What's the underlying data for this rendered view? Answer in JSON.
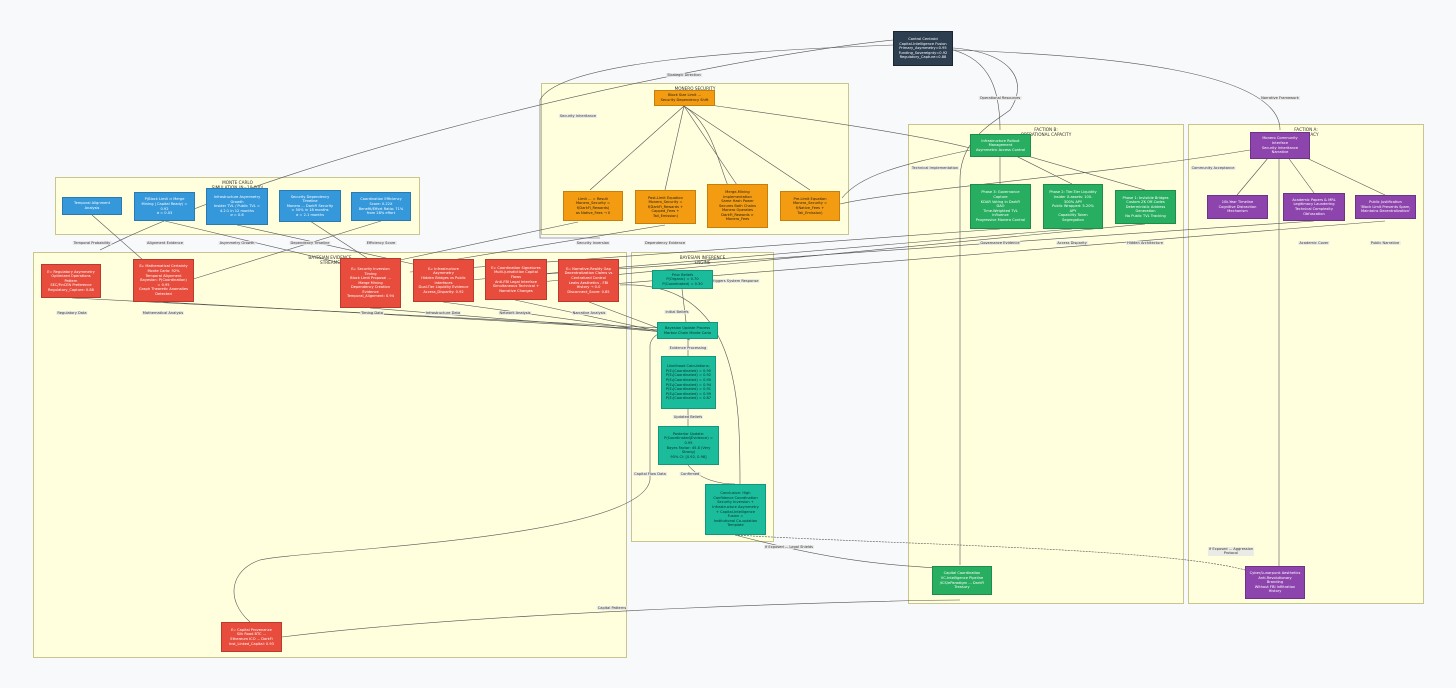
{
  "clusters": {
    "monero": "MONERO SECURITY",
    "monte": "MONTE CARLO\nSIMULATION (N=10,000)",
    "bayes_evidence": "BAYESIAN EVIDENCE\nSTREAMS",
    "bayes_engine": "BAYESIAN INFERENCE\nENGINE",
    "faction_b": "FACTION B:\nOPERATIONAL CAPACITY",
    "faction_a": "FACTION A:\nLEGITIMACY"
  },
  "nodes": {
    "control": "Control Centroid\nCapital-Intelligence Fusion\nPrimary_Asymmetry=0.95\nFunding_Sovereignty=0.92\nRegulatory_Capture=0.88",
    "monero_root": "Block Size Limit ...\nSecurity Dependency Shift",
    "limit": "Limit ... = Result\nMonero_Security =\nf(DarkFi_Rewards)\nas Native_Fees → 0",
    "postlimit": "Post-Limit Equation\nMonero_Security =\nf(DarkFi_Rewards +\nCapped_Fees +\nTail_Emission)",
    "merge": "Merge-Mining\nImplementation\nSame Hash Power\nSecures Both Chains\nMonero Operates\nDarkFi_Rewards >\nMonero_Fees",
    "prelimit": "Pre-Limit Equation\nMonero_Security =\nf(Native_Fees +\nTail_Emission)",
    "mc_temporal": "Temporal Alignment\nAnalysis",
    "mc_ppost": "P(Block Limit ⇒ Merge\nMining | Capital Ready) =\n0.92\nσ = 0.03",
    "mc_infra": "Infrastructure Asymmetry\nGrowth\nInsider TVL / Public TVL =\n4.2:1 in 12 months\nσ = 0.6",
    "mc_secdep": "Security Dependency\nTimeline\nMonero ... DarkFi Security\n> 50% in 18 months\nσ = 2.1 months",
    "mc_coord": "Coordination Efficiency\nScore: 0.22X\nBenefit/Effort Ratio: 71%\nfrom 28% effort",
    "ev_reg": "E₇: Regulatory Asymmetry\nOptimized Operations\nPattern\nSEC/FinCEN Preference\nRegulatory_Capture: 0.88",
    "ev_math": "E₆: Mathematical Certainty\nMonte Carlo: 92%\nTemporal Alignment\nBayesian: P(Coordination)\n= 0.95\nGraph Theoretic Anomalies\nDetected",
    "ev_secinv": "E₅: Security Inversion\nTiming\nBlock Limit Proposal ...\nMerge Mining\nDependency Creation\nEvidence\nTemporal_Alignment: 0.94",
    "ev_infra": "E₄: Infrastructure\nAsymmetry\nHidden Bridges vs Public\nInterfaces\nDual-Tier Liquidity Evidence\nAccess_Disparity: 0.92",
    "ev_coord": "E₃: Coordination Signatures\nMulti-Jurisdiction Capital\nFlows\nAnti-FBI Legal Interface\nSimultaneous Technical +\nNarrative Changes",
    "ev_narr": "E₂: Narrative-Reality Gap\nDecentralization Claims vs\nCentralized Control\nLeaks Aesthetics - FBI\nHistory → 0.0\nDisconnect_Score: 0.85",
    "ev_cap": "E₁: Capital Provenance\nSilk Road BTC ...\nEthereum ICO ... DarkFi\nInst_Linked_Capital: 0.93",
    "prior": "Prior Beliefs\nP(Organic) = 0.70\nP(Coordinated) = 0.30",
    "bayes_update": "Bayesian Update Process\nMarkov Chain Monte Carlo",
    "likelihood": "Likelihood Calculations:\nP(E₁|Coordinated) = 0.95\nP(E₂|Coordinated) = 0.92\nP(E₃|Coordinated) = 0.90\nP(E₄|Coordinated) = 0.94\nP(E₅|Coordinated) = 0.91\nP(E₆|Coordinated) = 0.99\nP(E₇|Coordinated) = 0.87",
    "posterior": "Posterior Update:\nP(Coordinated|Evidence) =\n0.95\nBayes Factor: 45.8 (Very\nStrong)\n95% CI: [0.92, 0.98]",
    "conclusion": "Conclusion: High\nConfidence Coordination\nSecurity Inversion +\nInfrastructure Asymmetry\n+ Capital-Intelligence\nFusion =\nInstitutional Co-optation\nTemplate",
    "fb_root": "Infrastructure Rollout\nManagement\nAsymmetric Access Control",
    "fb_p3": "Phase 3: Governance\nCapture\nKDAR Voting in DarkFi\nDAO\nTime-Weighted TVL\nInfluence\nProgressive Monero Control",
    "fb_p2": "Phase 2: Tier-Tier Liquidity\nInsider X-assets: 100-\n300% APY\nPublic Wrapped: 5-20%\nAPY\nCapability Token\nSegregation",
    "fb_p1": "Phase 1: Invisible Bridges\nCustom ZK Off-Codes\nDeterministic Address\nGeneration\nNo Public TVL Tracking",
    "fb_capital": "Capital Coordination\nVC-Intelligence Pipeline\n/ICS/eParadigm ... DarkFi\nTreasury",
    "fa_root": "Monero Community\nInterface\nSecurity Inheritance\nNarrative",
    "fa_10yr": "10k-Year Timeline\nCognitive Distraction\nMechanism",
    "fa_academic": "Academic Papers & MRL\nLegitimacy Laundering\nTechnical Complexity\nObfuscation",
    "fa_public": "Public Justification\n'Block Limit Prevents Spam,\nMaintains Decentralization'",
    "fa_cyber": "Cyber/Lunarpunk Aesthetics\nAnti-Revolutionary\nBranding\nWithout FBI Infiltration\nHistory"
  },
  "edge_labels": {
    "strategic": "Strategic Direction",
    "operational": "Operational Resources",
    "narrative": "Narrative Framework",
    "sec_inherit": "Security Inheritance",
    "tech_impl": "Technical Implementation",
    "community": "Community Acceptance",
    "temporal_prob": "Temporal Probability",
    "align_ev": "Alignment Evidence",
    "asym_growth": "Asymmetry Growth",
    "dep_timeline": "Dependency Timeline",
    "eff_score": "Efficiency Score",
    "sec_inversion": "Security Inversion",
    "dep_evidence": "Dependency Evidence",
    "gov_evidence": "Governance Evidence",
    "access_disparity": "Access Disparity",
    "hidden_arch": "Hidden Architecture",
    "academic_cover": "Academic Cover",
    "public_narr": "Public Narrative",
    "triggers": "Triggers System Response",
    "reg_data": "Regulatory Data",
    "math_analysis": "Mathematical Analysis",
    "timing_data": "Timing Data",
    "infra_data": "Infrastructure Data",
    "network_analysis": "Network Analysis",
    "narr_analysis": "Narrative Analysis",
    "initial_beliefs": "Initial Beliefs",
    "evidence_processing": "Evidence Processing",
    "updated_beliefs": "Updated Beliefs",
    "confirmed": "Confirmed",
    "capital_flow": "Capital Flow Data",
    "exposed_legal": "If Exposed ... Legal Shields",
    "exposed_aggr": "If Exposed ... Aggression\nProtocol",
    "capital_patterns": "Capital Patterns"
  }
}
